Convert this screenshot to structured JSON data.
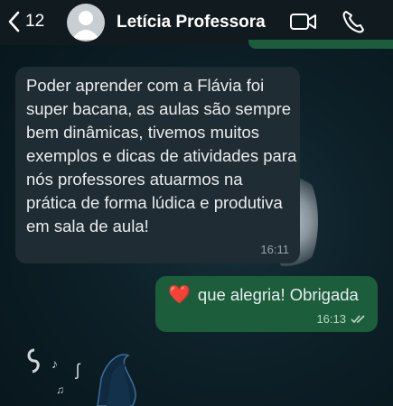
{
  "header": {
    "back_count": "12",
    "contact_name": "Letícia Professora",
    "icons": [
      "chevron-left-icon",
      "video-call-icon",
      "phone-call-icon"
    ]
  },
  "messages": [
    {
      "direction": "incoming",
      "text": "Poder aprender com a Flávia foi super bacana, as aulas são sempre bem dinâmicas, tivemos muitos exemplos e dicas de atividades para nós professores atuarmos na prática de forma lúdica e produtiva em sala de aula!",
      "time": "16:11"
    },
    {
      "direction": "outgoing",
      "emoji": "❤️",
      "text": "que alegria! Obrigada",
      "time": "16:13",
      "status": "read"
    }
  ],
  "colors": {
    "header_bg": "#101a1f",
    "incoming_bubble": "#202c33",
    "outgoing_bubble": "#1c5e3c",
    "background": "#0d1f27"
  }
}
